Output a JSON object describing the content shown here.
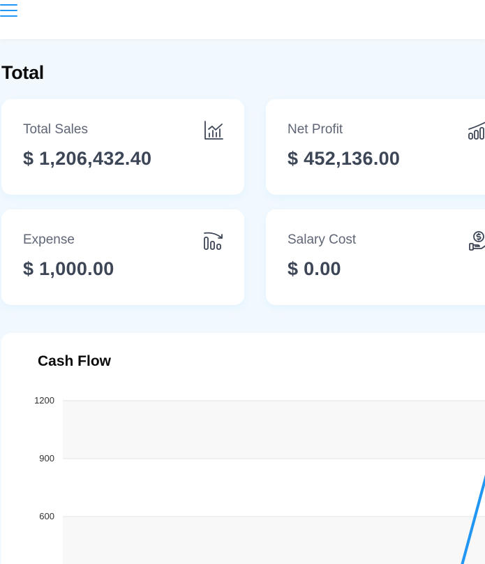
{
  "header": {
    "menu_icon": "hamburger-icon",
    "accent_color": "#2196f3"
  },
  "section": {
    "title": "Total"
  },
  "stats": [
    {
      "label": "Total Sales",
      "value": "$ 1,206,432.40",
      "icon": "chart-growth-icon"
    },
    {
      "label": "Net Profit",
      "value": "$ 452,136.00",
      "icon": "bar-trend-up-icon"
    },
    {
      "label": "Expense",
      "value": "$ 1,000.00",
      "icon": "bar-trend-down-icon"
    },
    {
      "label": "Salary Cost",
      "value": "$ 0.00",
      "icon": "hand-dollar-icon"
    }
  ],
  "chart_data": {
    "type": "line",
    "title": "Cash Flow",
    "y_ticks": [
      1200,
      900,
      600
    ],
    "ylim": [
      0,
      1200
    ],
    "grid": true,
    "series": [
      {
        "values": [],
        "color": "#2196f3"
      }
    ]
  }
}
